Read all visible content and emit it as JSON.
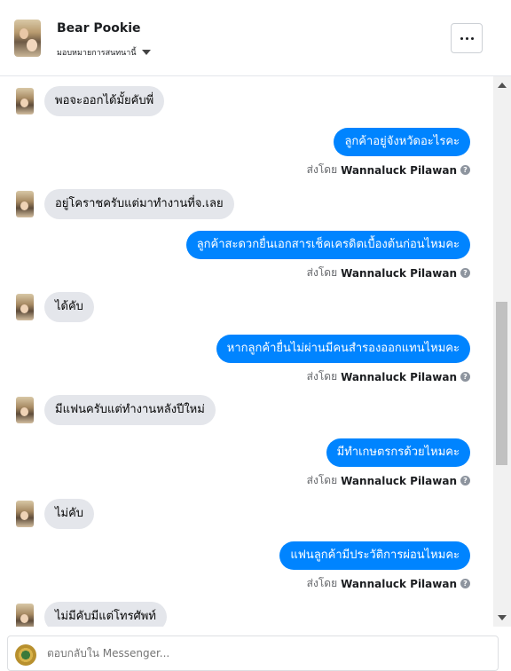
{
  "header": {
    "name": "Bear Pookie",
    "assign_label": "มอบหมายการสนทนานี้"
  },
  "messages": [
    {
      "dir": "in",
      "text": "พอจะออกได้มั้ยคับพี่"
    },
    {
      "dir": "out",
      "text": "ลูกค้าอยู่จังหวัดอะไรคะ",
      "sent_prefix": "ส่งโดย",
      "sent_by": "Wannaluck Pilawan"
    },
    {
      "dir": "in",
      "text": "อยู่โคราชครับแต่มาทำงานที่จ.เลย"
    },
    {
      "dir": "out",
      "text": "ลูกค้าสะดวกยื่นเอกสารเช็คเครดิตเบื้องต้นก่อนไหมคะ",
      "sent_prefix": "ส่งโดย",
      "sent_by": "Wannaluck Pilawan"
    },
    {
      "dir": "in",
      "text": "ได้คับ"
    },
    {
      "dir": "out",
      "text": "หากลูกค้ายื่นไม่ผ่านมีคนสำรองออกแทนไหมคะ",
      "sent_prefix": "ส่งโดย",
      "sent_by": "Wannaluck Pilawan"
    },
    {
      "dir": "in",
      "text": "มีแฟนครับแต่ทำงานหลังปีใหม่"
    },
    {
      "dir": "out",
      "text": "มีทำเกษตรกรด้วยไหมคะ",
      "sent_prefix": "ส่งโดย",
      "sent_by": "Wannaluck Pilawan"
    },
    {
      "dir": "in",
      "text": "ไม่คับ"
    },
    {
      "dir": "out",
      "text": "แฟนลูกค้ามีประวัติการผ่อนไหมคะ",
      "sent_prefix": "ส่งโดย",
      "sent_by": "Wannaluck Pilawan"
    },
    {
      "dir": "in",
      "text": "ไม่มีคับมีแต่โทรศัพท์"
    }
  ],
  "composer": {
    "placeholder": "ตอบกลับใน Messenger..."
  },
  "colors": {
    "outgoing_bubble": "#0084ff",
    "incoming_bubble": "#e4e6eb"
  },
  "icons": {
    "more": "more-options-icon",
    "caret": "caret-down-icon",
    "help": "help-circle-icon"
  }
}
